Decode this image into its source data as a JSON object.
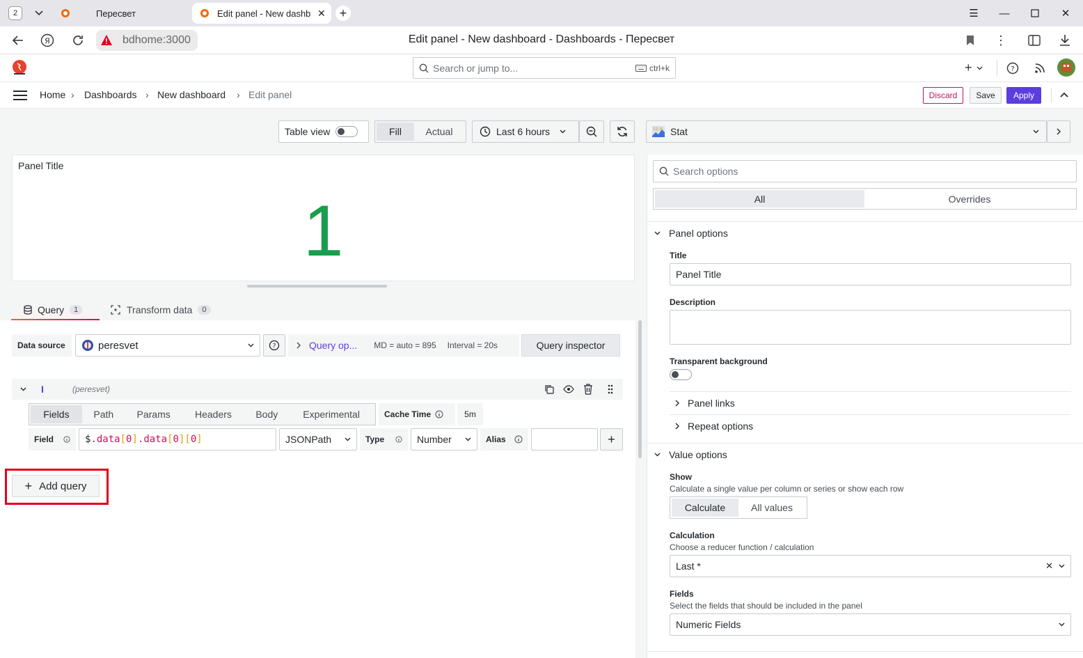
{
  "browser": {
    "tab_count": "2",
    "tabs": [
      {
        "label": "Пересвет",
        "active": false
      },
      {
        "label": "Edit panel - New dashb",
        "active": true
      }
    ],
    "url": "bdhome:3000",
    "page_title": "Edit panel - New dashboard - Dashboards - Пересвет"
  },
  "topnav": {
    "search_placeholder": "Search or jump to...",
    "search_shortcut": "ctrl+k",
    "add_label": "+"
  },
  "breadcrumb": {
    "items": [
      "Home",
      "Dashboards",
      "New dashboard",
      "Edit panel"
    ],
    "discard": "Discard",
    "save": "Save",
    "apply": "Apply"
  },
  "toolbar": {
    "table_view": "Table view",
    "fill": "Fill",
    "actual": "Actual",
    "time_range": "Last 6 hours",
    "visualization": "Stat"
  },
  "panel": {
    "title": "Panel Title",
    "value": "1"
  },
  "query_tabs": {
    "query_label": "Query",
    "query_count": "1",
    "transform_label": "Transform data",
    "transform_count": "0"
  },
  "query_row": {
    "datasource_label": "Data source",
    "datasource_value": "peresvet",
    "query_options": "Query op...",
    "md": "MD = auto = 895",
    "interval": "Interval = 20s",
    "inspector": "Query inspector"
  },
  "query": {
    "ref_id": "I",
    "ds_name": "(peresvet)",
    "tabs": [
      "Fields",
      "Path",
      "Params",
      "Headers",
      "Body",
      "Experimental"
    ],
    "cache_time_label": "Cache Time",
    "cache_time_value": "5m",
    "field_label": "Field",
    "field_value": "$.data[0].data[0][0]",
    "field_value_parts": [
      "$",
      ".data",
      "[",
      "0",
      "]",
      ".data",
      "[",
      "0",
      "]",
      "[",
      "0",
      "]"
    ],
    "parser": "JSONPath",
    "type_label": "Type",
    "type_value": "Number",
    "alias_label": "Alias",
    "alias_value": ""
  },
  "add_query": "Add query",
  "options": {
    "search_placeholder": "Search options",
    "tab_all": "All",
    "tab_overrides": "Overrides",
    "panel_options": "Panel options",
    "title_label": "Title",
    "title_value": "Panel Title",
    "description_label": "Description",
    "description_value": "",
    "transparent_label": "Transparent background",
    "panel_links": "Panel links",
    "repeat_options": "Repeat options",
    "value_options": "Value options",
    "show_label": "Show",
    "show_desc": "Calculate a single value per column or series or show each row",
    "show_calculate": "Calculate",
    "show_all_values": "All values",
    "calculation_label": "Calculation",
    "calculation_desc": "Choose a reducer function / calculation",
    "calculation_value": "Last *",
    "fields_label": "Fields",
    "fields_desc": "Select the fields that should be included in the panel",
    "fields_value": "Numeric Fields"
  },
  "colors": {
    "accent": "#3d71d9",
    "apply": "#5c3de0",
    "discard": "#d10e5c",
    "value_green": "#1a9e4d",
    "highlight_red": "#e0001b"
  }
}
